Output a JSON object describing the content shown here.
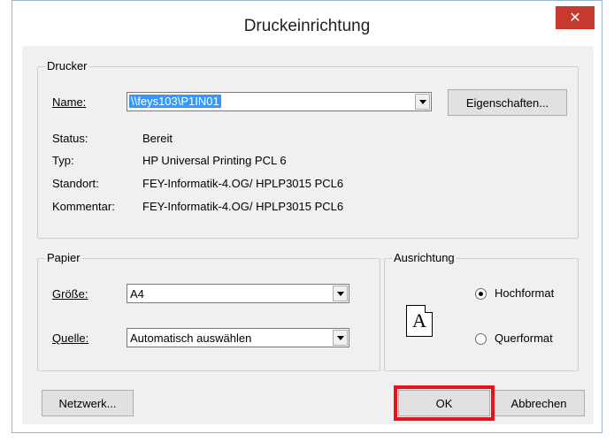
{
  "window": {
    "title": "Druckeinrichtung",
    "close_glyph": "✕"
  },
  "printer": {
    "group_label": "Drucker",
    "name_label": "Name:",
    "name_value": "\\\\feys103\\P1IN01",
    "properties_button": "Eigenschaften...",
    "status_label": "Status:",
    "status_value": "Bereit",
    "type_label": "Typ:",
    "type_value": "HP Universal Printing PCL 6",
    "location_label": "Standort:",
    "location_value": "FEY-Informatik-4.OG/  HPLP3015 PCL6",
    "comment_label": "Kommentar:",
    "comment_value": "FEY-Informatik-4.OG/  HPLP3015 PCL6"
  },
  "paper": {
    "group_label": "Papier",
    "size_label": "Größe:",
    "size_value": "A4",
    "source_label": "Quelle:",
    "source_value": "Automatisch auswählen"
  },
  "orientation": {
    "group_label": "Ausrichtung",
    "page_glyph": "A",
    "portrait_label": "Hochformat",
    "landscape_label": "Querformat",
    "selected": "portrait"
  },
  "buttons": {
    "network": "Netzwerk...",
    "ok": "OK",
    "cancel": "Abbrechen"
  },
  "colors": {
    "highlight": "#e8121b",
    "close": "#c7382f",
    "selection": "#3399ff"
  }
}
